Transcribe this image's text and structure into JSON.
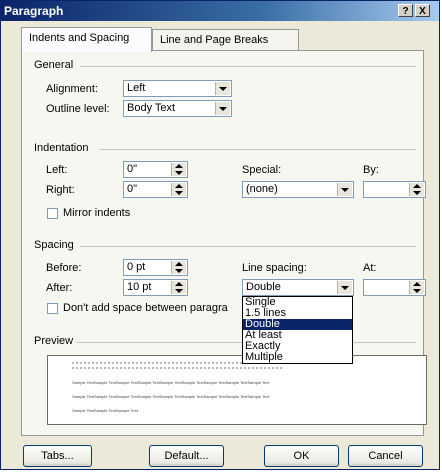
{
  "window": {
    "title": "Paragraph",
    "help_button": "?",
    "close_button": "X"
  },
  "tabs": [
    {
      "label": "Indents and Spacing",
      "active": true
    },
    {
      "label": "Line and Page Breaks",
      "active": false
    }
  ],
  "general": {
    "group_label": "General",
    "alignment_label": "Alignment:",
    "alignment_value": "Left",
    "outline_label": "Outline level:",
    "outline_value": "Body Text"
  },
  "indentation": {
    "group_label": "Indentation",
    "left_label": "Left:",
    "left_value": "0\"",
    "right_label": "Right:",
    "right_value": "0\"",
    "special_label": "Special:",
    "special_value": "(none)",
    "by_label": "By:",
    "by_value": "",
    "mirror_label": "Mirror indents",
    "mirror_checked": false
  },
  "spacing": {
    "group_label": "Spacing",
    "before_label": "Before:",
    "before_value": "0 pt",
    "after_label": "After:",
    "after_value": "10 pt",
    "line_spacing_label": "Line spacing:",
    "line_spacing_value": "Double",
    "at_label": "At:",
    "at_value": "",
    "dont_add_label": "Don't add space between paragra",
    "dont_add_checked": false,
    "line_spacing_options": [
      "Single",
      "1.5 lines",
      "Double",
      "At least",
      "Exactly",
      "Multiple"
    ],
    "selected_option": "Double"
  },
  "preview": {
    "group_label": "Preview",
    "sample_line": "Sample TextSample TextSample TextSample TextSample TextSample TextSample TextSample TextSample Text",
    "sample_line_short": "Sample TextSample TextSample Text"
  },
  "buttons": {
    "tabs": "Tabs...",
    "default": "Default...",
    "ok": "OK",
    "cancel": "Cancel"
  },
  "colors": {
    "titlebar": "#0a246a",
    "selection": "#0a246a",
    "dialog_bg": "#ece9d8"
  }
}
